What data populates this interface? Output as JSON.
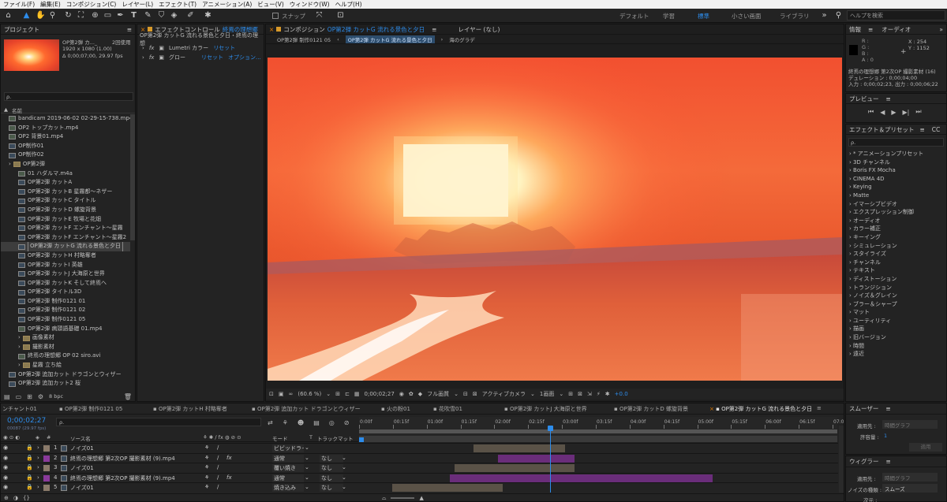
{
  "menu": [
    "ファイル(F)",
    "編集(E)",
    "コンポジション(C)",
    "レイヤー(L)",
    "エフェクト(T)",
    "アニメーション(A)",
    "ビュー(V)",
    "ウィンドウ(W)",
    "ヘルプ(H)"
  ],
  "toolbar": {
    "snap": "スナップ",
    "workspaces": [
      "デフォルト",
      "学習",
      "標準",
      "小さい画面",
      "ライブラリ"
    ],
    "search_placeholder": "ヘルプを検索"
  },
  "project": {
    "title": "プロジェクト",
    "selected_name": "OP第2弾 カ..._",
    "usage": "2回使用",
    "dims": "1920 x 1080 (1.00)",
    "duration": "Δ 0;00;07;00, 29.97 fps",
    "search": "ρ.",
    "column": "名前",
    "items": [
      {
        "label": "bandicam 2019-06-02 02-29-15-738.mp4",
        "type": "file",
        "indent": 0
      },
      {
        "label": "OP2 トップカット.mp4",
        "type": "file",
        "indent": 0
      },
      {
        "label": "OP2 背景01.mp4",
        "type": "file",
        "indent": 0
      },
      {
        "label": "OP制作01",
        "type": "comp",
        "indent": 0
      },
      {
        "label": "OP制作02",
        "type": "comp",
        "indent": 0
      },
      {
        "label": "OP第2弾",
        "type": "folder",
        "indent": 0
      },
      {
        "label": "01 ハダルマ.m4a",
        "type": "file",
        "indent": 1
      },
      {
        "label": "OP第2弾 カットA",
        "type": "comp",
        "indent": 1
      },
      {
        "label": "OP第2弾 カットB 星霧都〜ネザー",
        "type": "comp",
        "indent": 1
      },
      {
        "label": "OP第2弾 カットC タイトル",
        "type": "comp",
        "indent": 1
      },
      {
        "label": "OP第2弾 カットD 螺旋背景",
        "type": "comp",
        "indent": 1
      },
      {
        "label": "OP第2弾 カットE 牧場と花畑",
        "type": "comp",
        "indent": 1
      },
      {
        "label": "OP第2弾 カットF エンチャント〜星霧",
        "type": "comp",
        "indent": 1
      },
      {
        "label": "OP第2弾 カットF エンチャント〜星霧2",
        "type": "comp",
        "indent": 1
      },
      {
        "label": "OP第2弾 カットG 流れる景色と夕日",
        "type": "comp",
        "indent": 1,
        "selected": true
      },
      {
        "label": "OP第2弾 カットH 村略奪者",
        "type": "comp",
        "indent": 1
      },
      {
        "label": "OP第2弾 カットI 英雄",
        "type": "comp",
        "indent": 1
      },
      {
        "label": "OP第2弾 カットJ 大海原と世界",
        "type": "comp",
        "indent": 1
      },
      {
        "label": "OP第2弾 カットK そして終焉へ",
        "type": "comp",
        "indent": 1
      },
      {
        "label": "OP第2弾 タイトル3D",
        "type": "comp",
        "indent": 1
      },
      {
        "label": "OP第2弾 制作0121 01",
        "type": "comp",
        "indent": 1
      },
      {
        "label": "OP第2弾 制作0121 02",
        "type": "comp",
        "indent": 1
      },
      {
        "label": "OP第2弾 制作0121 05",
        "type": "comp",
        "indent": 1
      },
      {
        "label": "OP第2弾 病頭語基礎 01.mp4",
        "type": "file",
        "indent": 1
      },
      {
        "label": "画像素材",
        "type": "folder",
        "indent": 1
      },
      {
        "label": "撮影素材",
        "type": "folder",
        "indent": 1
      },
      {
        "label": "終焉の理想郷 OP 02 siro.avi",
        "type": "file",
        "indent": 1
      },
      {
        "label": "星霧 立ち絵",
        "type": "folder",
        "indent": 1
      },
      {
        "label": "OP第2弾 追加カット ドラゴンとウィザー",
        "type": "comp",
        "indent": 0
      },
      {
        "label": "OP第2弾 追加カット2 桜",
        "type": "comp",
        "indent": 0
      }
    ],
    "bpc": "8 bpc"
  },
  "effect_controls": {
    "tab": "エフェクトコントロール",
    "tab_layer": "終焉の理想郷",
    "path": "OP第2弾 カットG 流れる景色と夕日・終焉の理想",
    "effects": [
      {
        "name": "Lumetri カラー",
        "reset": "リセット",
        "extra": ""
      },
      {
        "name": "グロー",
        "reset": "リセット",
        "extra": "オプション..."
      }
    ]
  },
  "composition": {
    "tab": "コンポジション",
    "tab_name": "OP第2弾 カットG 流れる景色と夕日",
    "layer_tab": "レイヤー (なし)",
    "breadcrumb": [
      "OP第2弾 制作0121 05",
      "OP第2弾 カットG 流れる景色と夕日",
      "海のグラデ"
    ],
    "zoom": "(60.6 %)",
    "time": "0;00;02;27",
    "quality": "フル画質",
    "camera": "アクティブカメラ",
    "views": "1画面",
    "exposure": "+0.0"
  },
  "info": {
    "title": "情報",
    "audio": "オーディオ",
    "rgba": [
      "R :",
      "G :",
      "B :",
      "A : 0"
    ],
    "x": "X : 254",
    "y": "Y : 1152",
    "layer": "終焉の理想郷 第2次OP 撮影素材 (16)",
    "duration": "デュレーション : 0;00;04;00",
    "inout": "入力 : 0;00;02;23, 出力 : 0;00;06;22"
  },
  "preview": {
    "title": "プレビュー"
  },
  "effects_presets": {
    "title": "エフェクト＆プリセット",
    "cc": "CC",
    "search": "ρ.",
    "items": [
      "* アニメーションプリセット",
      "3D チャンネル",
      "Boris FX Mocha",
      "CINEMA 4D",
      "Keying",
      "Matte",
      "イマーシブビデオ",
      "エクスプレッション制御",
      "オーディオ",
      "カラー補正",
      "キーイング",
      "シミュレーション",
      "スタイライズ",
      "チャンネル",
      "テキスト",
      "ディストーション",
      "トランジション",
      "ノイズ＆グレイン",
      "ブラー＆シャープ",
      "マット",
      "ユーティリティ",
      "描画",
      "旧バージョン",
      "時間",
      "遠近"
    ]
  },
  "smoother": {
    "title": "スムーザー",
    "apply_label": "適用先 :",
    "apply_value": "時間グラフ",
    "tolerance_label": "許容量 :",
    "tolerance_value": "1",
    "apply_button": "適用"
  },
  "wiggler": {
    "title": "ウィグラー",
    "apply_label": "適用先 :",
    "apply_value": "時間グラフ",
    "noise_label": "ノイズの種類 :",
    "noise_value": "スムーズ",
    "dim_label": "次元 :"
  },
  "timeline": {
    "tabs": [
      "ンチャント01",
      "OP第2弾 制作0121 05",
      "OP第2弾 カットH 村略奪者",
      "OP第2弾 追加カット ドラゴンとウィザー",
      "火の粉01",
      "花吹雪01",
      "OP第2弾 カットJ 大海原と世界",
      "OP第2弾 カットD 螺旋背景",
      "OP第2弾 カットG 流れる景色と夕日"
    ],
    "timecode": "0;00;02;27",
    "fps": "00087 (29.97 fps)",
    "header": {
      "source": "ソース名",
      "mode": "モード",
      "t": "T",
      "track": "トラックマット"
    },
    "ruler": [
      "0:00f",
      "00:15f",
      "01:00f",
      "01:15f",
      "02:00f",
      "02:15f",
      "03:00f",
      "03:15f",
      "04:00f",
      "04:15f",
      "05:00f",
      "05:15f",
      "06:00f",
      "06:15f",
      "07:0"
    ],
    "playhead": 0.4,
    "layers": [
      {
        "num": "1",
        "name": "ノイズ01",
        "color": "#8a7a6a",
        "mode": "ビビッドライ",
        "track": "",
        "bar_start": 0.24,
        "bar_end": 0.43,
        "bar_color": "#5a5247"
      },
      {
        "num": "2",
        "name": "終焉の理想郷 第2次OP 撮影素材 (9).mp4",
        "color": "#8a3a9a",
        "mode": "通常",
        "track": "なし",
        "bar_start": 0.29,
        "bar_end": 0.45,
        "bar_color": "#6a2d7a"
      },
      {
        "num": "3",
        "name": "ノイズ01",
        "color": "#8a7a6a",
        "mode": "覆い焼き",
        "track": "なし",
        "bar_start": 0.2,
        "bar_end": 0.45,
        "bar_color": "#5a5247"
      },
      {
        "num": "4",
        "name": "終焉の理想郷 第2次OP 撮影素材 (9).mp4",
        "color": "#8a3a9a",
        "mode": "通常",
        "track": "なし",
        "bar_start": 0.19,
        "bar_end": 0.74,
        "bar_color": "#6a2d7a"
      },
      {
        "num": "5",
        "name": "ノイズ01",
        "color": "#8a7a6a",
        "mode": "焼き込み",
        "track": "なし",
        "bar_start": 0.07,
        "bar_end": 0.3,
        "bar_color": "#5a5247"
      }
    ]
  }
}
